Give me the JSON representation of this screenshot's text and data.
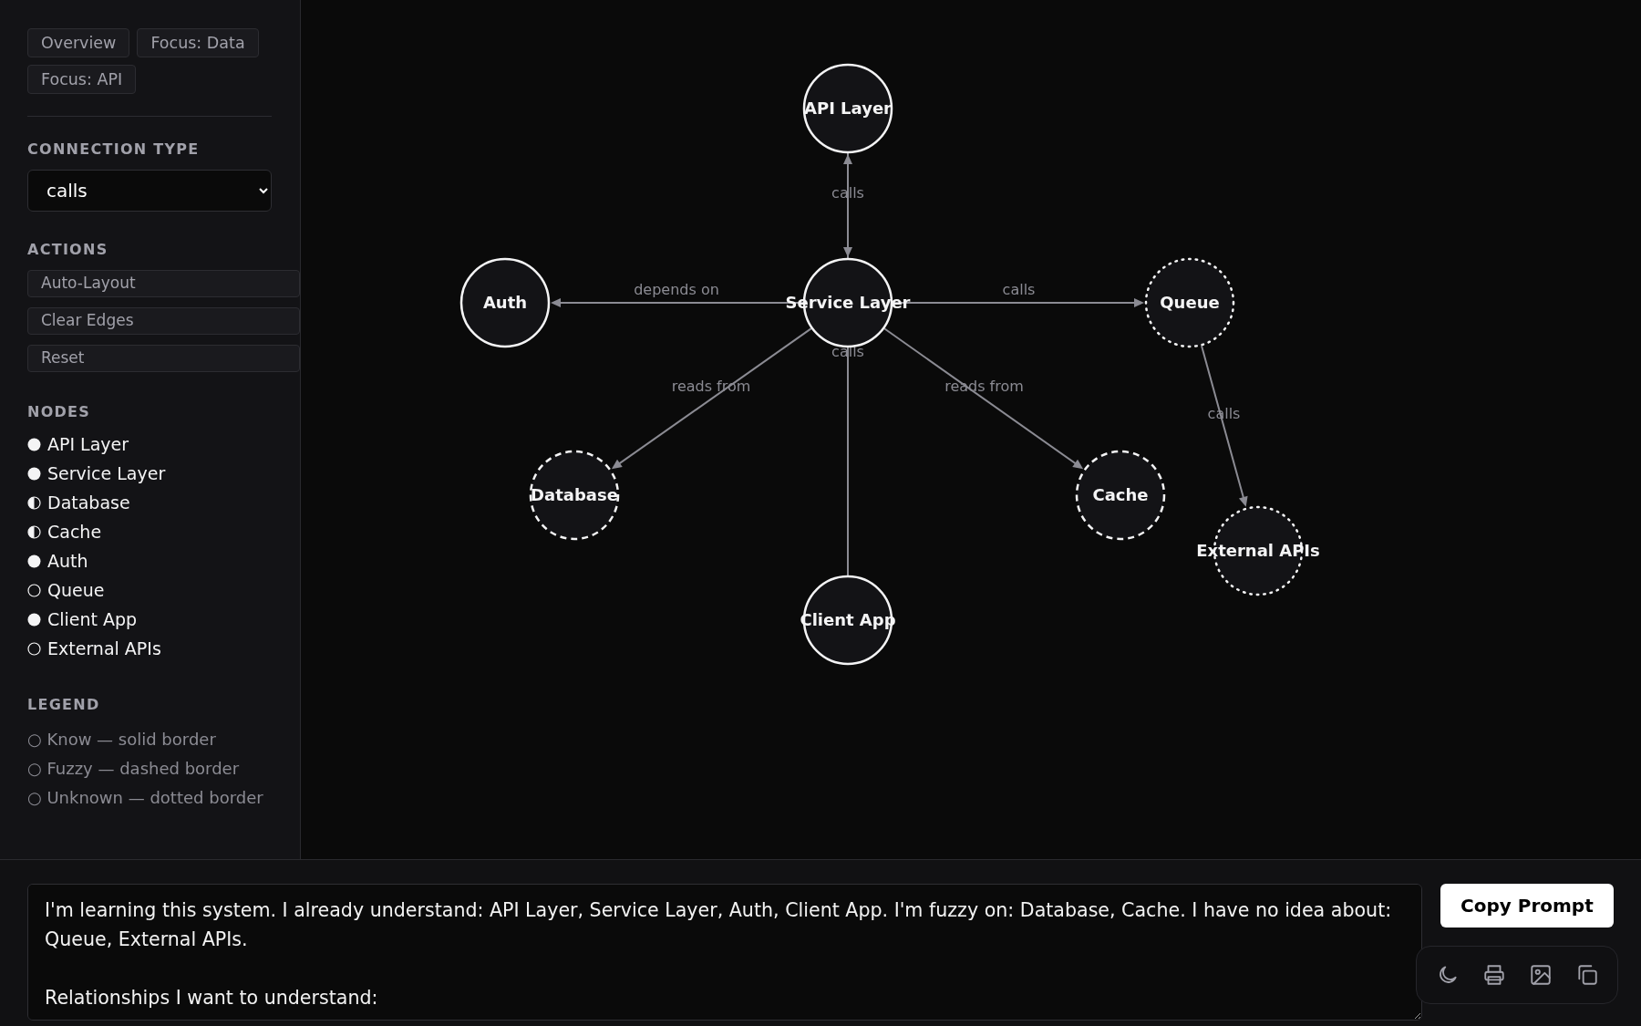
{
  "presets": [
    {
      "label": "Overview"
    },
    {
      "label": "Focus: Data"
    },
    {
      "label": "Focus: API"
    }
  ],
  "connection_type": {
    "heading": "CONNECTION TYPE",
    "value": "calls"
  },
  "actions": {
    "heading": "ACTIONS",
    "buttons": [
      "Auto-Layout",
      "Clear Edges",
      "Reset"
    ]
  },
  "nodes_panel": {
    "heading": "NODES"
  },
  "nodes": [
    {
      "label": "API Layer",
      "kind": "know"
    },
    {
      "label": "Service Layer",
      "kind": "know"
    },
    {
      "label": "Database",
      "kind": "fuzzy"
    },
    {
      "label": "Cache",
      "kind": "fuzzy"
    },
    {
      "label": "Auth",
      "kind": "know"
    },
    {
      "label": "Queue",
      "kind": "unknown"
    },
    {
      "label": "Client App",
      "kind": "know"
    },
    {
      "label": "External APIs",
      "kind": "unknown"
    }
  ],
  "legend": {
    "heading": "LEGEND",
    "items": [
      {
        "text": "○ Know — solid border"
      },
      {
        "text": "○ Fuzzy — dashed border"
      },
      {
        "text": "○ Unknown — dotted border"
      }
    ]
  },
  "graph": {
    "node_labels": [
      "API Layer",
      "Service Layer",
      "Database",
      "Cache",
      "Auth",
      "Queue",
      "Client App",
      "External APIs"
    ],
    "edges": [
      {
        "label": "calls"
      },
      {
        "label": "calls"
      },
      {
        "label": "depends on"
      },
      {
        "label": "calls"
      },
      {
        "label": "reads from"
      },
      {
        "label": "reads from"
      },
      {
        "label": "calls"
      }
    ]
  },
  "prompt": {
    "value": "I'm learning this system. I already understand: API Layer, Service Layer, Auth, Client App. I'm fuzzy on: Database, Cache. I have no idea about: Queue, External APIs.\n\nRelationships I want to understand:"
  },
  "copy_button": "Copy Prompt",
  "toolbar": [
    {
      "kind": "moon"
    },
    {
      "kind": "print"
    },
    {
      "kind": "image"
    },
    {
      "kind": "copy"
    }
  ]
}
